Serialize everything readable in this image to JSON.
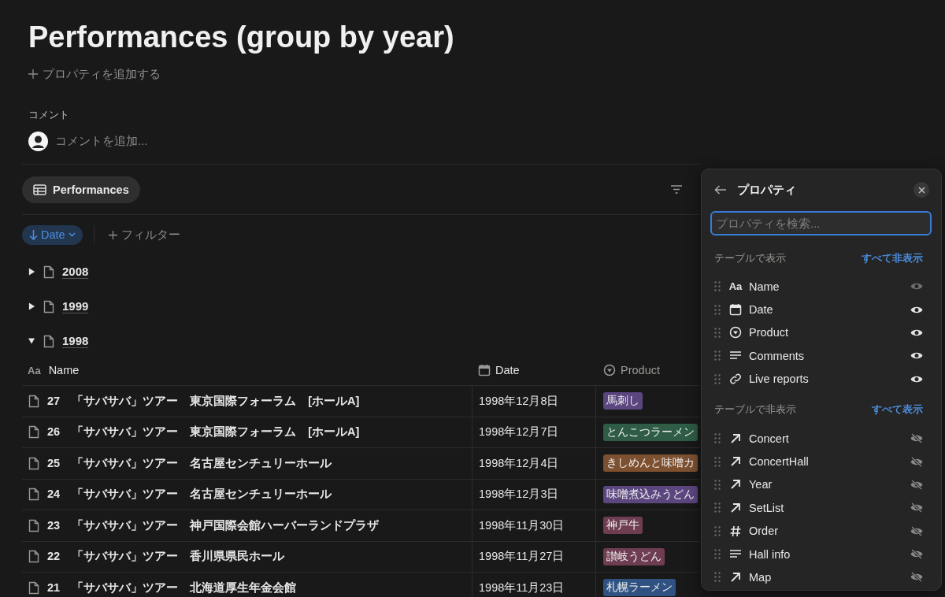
{
  "page": {
    "title": "Performances (group by year)",
    "add_property": "プロパティを追加する"
  },
  "comments": {
    "label": "コメント",
    "placeholder": "コメントを追加..."
  },
  "view_tab": {
    "label": "Performances"
  },
  "sort_chip": {
    "label": "Date"
  },
  "filter_button": {
    "label": "フィルター"
  },
  "groups": [
    {
      "label": "2008",
      "expanded": false
    },
    {
      "label": "1999",
      "expanded": false
    },
    {
      "label": "1998",
      "expanded": true
    }
  ],
  "table": {
    "columns": [
      {
        "label": "Name",
        "kind": "text",
        "icon": "Aa"
      },
      {
        "label": "Date",
        "kind": "date"
      },
      {
        "label": "Product",
        "kind": "select"
      }
    ],
    "rows": [
      {
        "name": "27　「サバサバ」ツアー　東京国際フォーラム　[ホールA]",
        "date": "1998年12月8日",
        "product": "馬刺し",
        "color": "#5b4680"
      },
      {
        "name": "26　「サバサバ」ツアー　東京国際フォーラム　[ホールA]",
        "date": "1998年12月7日",
        "product": "とんこつラーメン",
        "color": "#2e5c45"
      },
      {
        "name": "25　「サバサバ」ツアー　名古屋センチュリーホール",
        "date": "1998年12月4日",
        "product": "きしめんと味噌カ",
        "color": "#7d5030"
      },
      {
        "name": "24　「サバサバ」ツアー　名古屋センチュリーホール",
        "date": "1998年12月3日",
        "product": "味噌煮込みうどん",
        "color": "#5b4680"
      },
      {
        "name": "23　「サバサバ」ツアー　神戸国際会館ハーバーランドプラザ",
        "date": "1998年11月30日",
        "product": "神戸牛",
        "color": "#6e3d52"
      },
      {
        "name": "22　「サバサバ」ツアー　香川県県民ホール",
        "date": "1998年11月27日",
        "product": "讃岐うどん",
        "color": "#6e3d52"
      },
      {
        "name": "21　「サバサバ」ツアー　北海道厚生年金会館",
        "date": "1998年11月23日",
        "product": "札幌ラーメン",
        "color": "#2f5283"
      }
    ]
  },
  "properties_panel": {
    "title": "プロパティ",
    "search": {
      "placeholder": "プロパティを検索..."
    },
    "sections": [
      {
        "label": "テーブルで表示",
        "action": "すべて非表示",
        "items": [
          {
            "name": "Name",
            "kind": "text",
            "icon": "Aa",
            "visible": true,
            "locked": true
          },
          {
            "name": "Date",
            "kind": "date",
            "visible": true,
            "locked": false
          },
          {
            "name": "Product",
            "kind": "select",
            "visible": true,
            "locked": false
          },
          {
            "name": "Comments",
            "kind": "lines",
            "visible": true,
            "locked": false
          },
          {
            "name": "Live reports",
            "kind": "link",
            "visible": true,
            "locked": false
          }
        ]
      },
      {
        "label": "テーブルで非表示",
        "action": "すべて表示",
        "items": [
          {
            "name": "Concert",
            "kind": "relation",
            "visible": false,
            "locked": false
          },
          {
            "name": "ConcertHall",
            "kind": "relation",
            "visible": false,
            "locked": false
          },
          {
            "name": "Year",
            "kind": "relation",
            "visible": false,
            "locked": false
          },
          {
            "name": "SetList",
            "kind": "relation",
            "visible": false,
            "locked": false
          },
          {
            "name": "Order",
            "kind": "number",
            "visible": false,
            "locked": false
          },
          {
            "name": "Hall info",
            "kind": "lines",
            "visible": false,
            "locked": false
          },
          {
            "name": "Map",
            "kind": "relation",
            "visible": false,
            "locked": false
          }
        ]
      }
    ]
  }
}
